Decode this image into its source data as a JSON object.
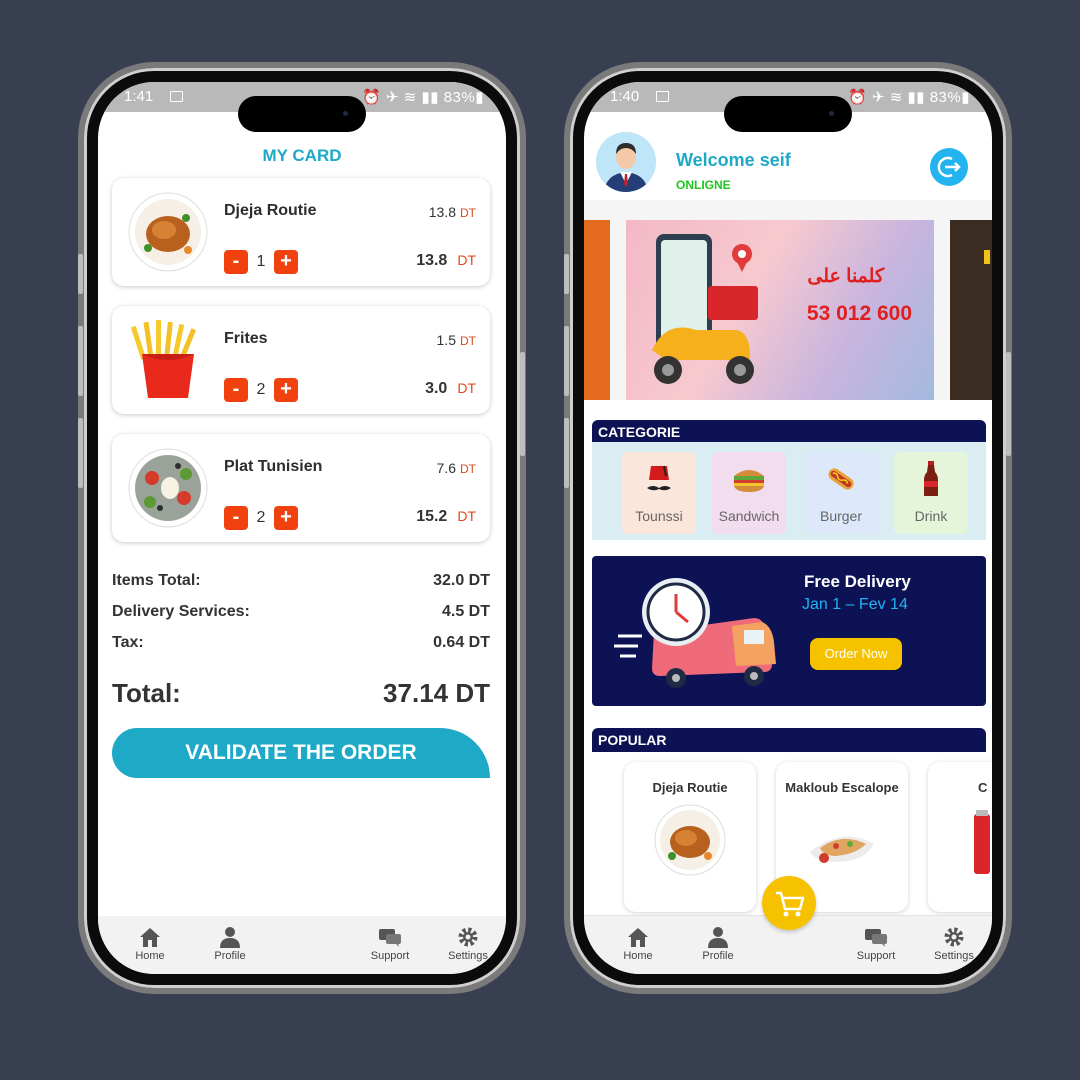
{
  "left_phone": {
    "status": {
      "time": "1:41",
      "battery": "83%"
    },
    "title": "MY CARD",
    "items": [
      {
        "name": "Djeja Routie",
        "unit_price": "13.8",
        "qty": "1",
        "line_total": "13.8"
      },
      {
        "name": "Frites",
        "unit_price": "1.5",
        "qty": "2",
        "line_total": "3.0"
      },
      {
        "name": "Plat Tunisien",
        "unit_price": "7.6",
        "qty": "2",
        "line_total": "15.2"
      }
    ],
    "currency": "DT",
    "minus": "-",
    "plus": "+",
    "summary": {
      "items_total_label": "Items Total:",
      "items_total_value": "32.0 DT",
      "delivery_label": "Delivery Services:",
      "delivery_value": "4.5 DT",
      "tax_label": "Tax:",
      "tax_value": "0.64 DT",
      "total_label": "Total:",
      "total_value": "37.14 DT"
    },
    "validate_label": "VALIDATE THE ORDER",
    "tabs": {
      "home": "Home",
      "profile": "Profile",
      "support": "Support",
      "settings": "Settings"
    }
  },
  "right_phone": {
    "status": {
      "time": "1:40",
      "battery": "83%"
    },
    "welcome": "Welcome seif",
    "online": "ONLIGNE",
    "banner": {
      "arabic": "كلمنا على",
      "phone": "53 012 600"
    },
    "categorie_label": "CATEGORIE",
    "categories": [
      {
        "name": "Tounssi",
        "icon": "fez-icon",
        "bg": "#fbe6dc"
      },
      {
        "name": "Sandwich",
        "icon": "sandwich-icon",
        "bg": "#f2ddef"
      },
      {
        "name": "Burger",
        "icon": "hotdog-icon",
        "bg": "#dde8fb"
      },
      {
        "name": "Drink",
        "icon": "bottle-icon",
        "bg": "#e5f5d9"
      }
    ],
    "promo": {
      "title": "Free Delivery",
      "dates": "Jan 1 – Fev 14",
      "button": "Order Now"
    },
    "popular_label": "POPULAR",
    "popular": [
      {
        "name": "Djeja Routie"
      },
      {
        "name": "Makloub Escalope"
      },
      {
        "name": "C"
      }
    ],
    "tabs": {
      "home": "Home",
      "profile": "Profile",
      "support": "Support",
      "settings": "Settings"
    }
  },
  "colors": {
    "accent": "#1ea9c7",
    "orange": "#f0410e",
    "navy": "#0d1254",
    "yellow": "#f6c200",
    "online": "#1ec41e"
  }
}
